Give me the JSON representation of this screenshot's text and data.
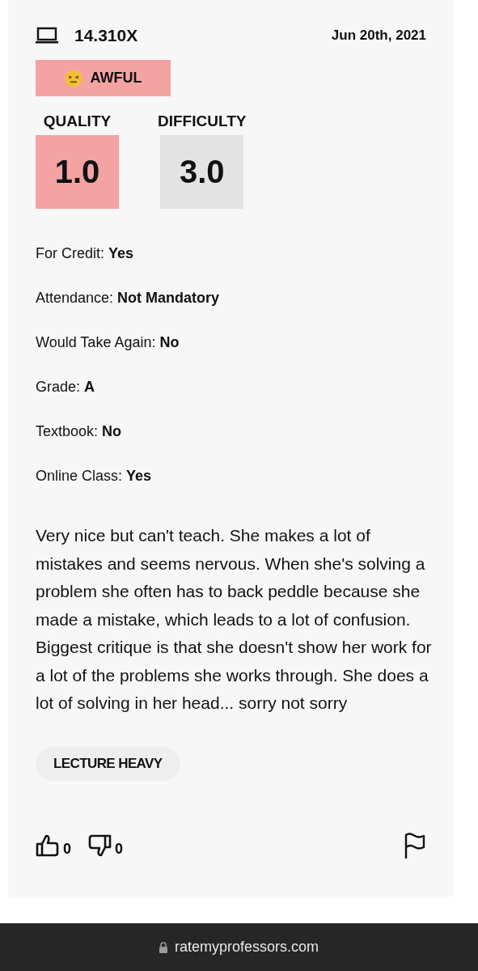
{
  "course": "14.310X",
  "date": "Jun 20th, 2021",
  "rating_label": {
    "text": "AWFUL",
    "color": "#f4a3a3"
  },
  "scores": [
    {
      "label": "QUALITY",
      "value": "1.0",
      "color": "#f4a3a3"
    },
    {
      "label": "DIFFICULTY",
      "value": "3.0",
      "color": "#e3e3e3"
    }
  ],
  "details": [
    {
      "label": "For Credit:",
      "value": "Yes"
    },
    {
      "label": "Attendance:",
      "value": "Not Mandatory"
    },
    {
      "label": "Would Take Again:",
      "value": "No"
    },
    {
      "label": "Grade:",
      "value": "A"
    },
    {
      "label": "Textbook:",
      "value": "No"
    },
    {
      "label": "Online Class:",
      "value": "Yes"
    }
  ],
  "comment": "Very nice but can't teach. She makes a lot of mistakes and seems nervous. When she's solving a problem she often has to back peddle because she made a mistake, which leads to a lot of confusion. Biggest critique is that she doesn't show her work for a lot of the problems she works through. She does a lot of solving in her head... sorry not sorry",
  "tags": [
    "LECTURE HEAVY"
  ],
  "votes": {
    "up": "0",
    "down": "0"
  },
  "address_bar": {
    "url": "ratemyprofessors.com"
  }
}
